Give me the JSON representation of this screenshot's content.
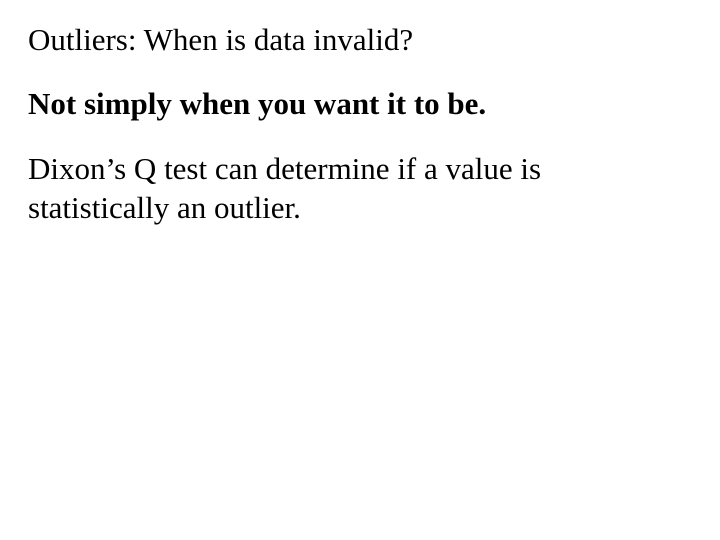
{
  "title": "Outliers:  When is data invalid?",
  "emphasis": "Not simply when you want it to be.",
  "body": "Dixon’s Q test can determine if a value is statistically an outlier."
}
